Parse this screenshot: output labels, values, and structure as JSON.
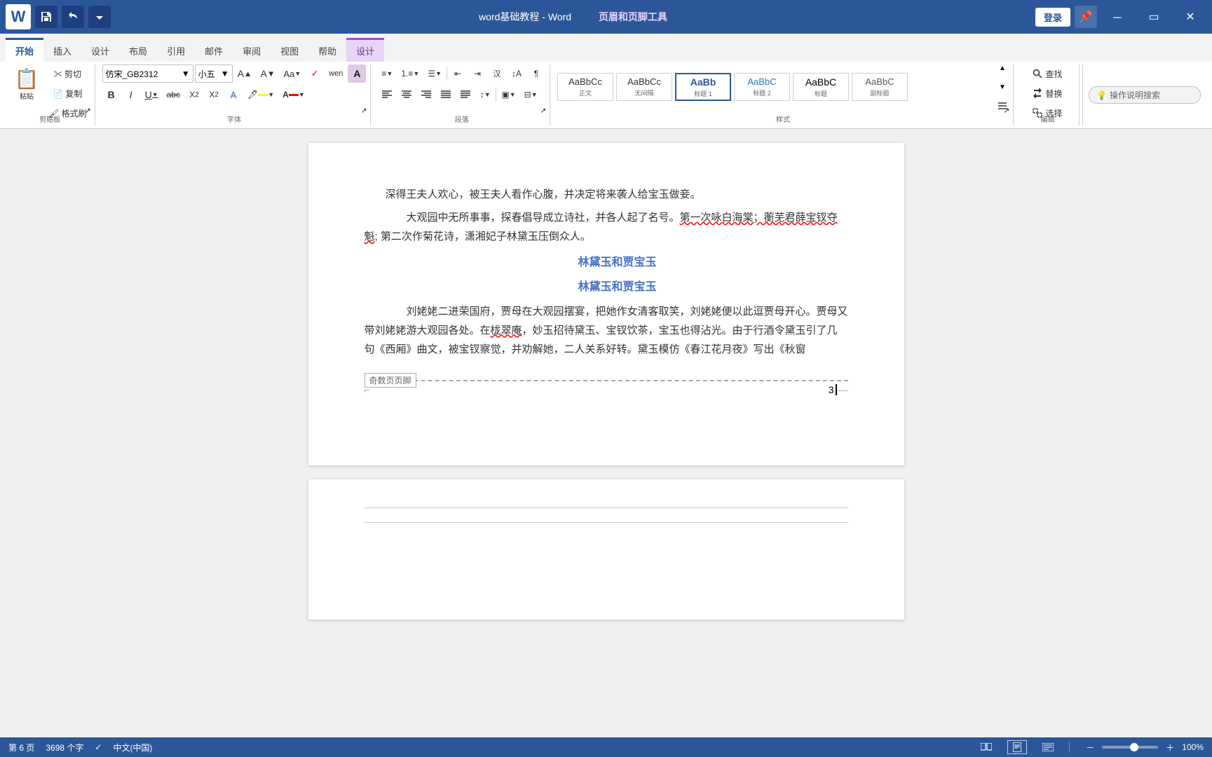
{
  "titleBar": {
    "appName": "Word",
    "docTitle": "word基础教程 - Word",
    "contextTab": "页眉和页脚工具",
    "loginBtn": "登录",
    "minimizeBtn": "－",
    "maximizeBtn": "▭",
    "closeBtn": "✕"
  },
  "tabs": [
    {
      "id": "start",
      "label": "开始",
      "active": true
    },
    {
      "id": "insert",
      "label": "插入"
    },
    {
      "id": "design",
      "label": "设计"
    },
    {
      "id": "layout",
      "label": "布局"
    },
    {
      "id": "references",
      "label": "引用"
    },
    {
      "id": "mail",
      "label": "邮件"
    },
    {
      "id": "review",
      "label": "审阅"
    },
    {
      "id": "view",
      "label": "视图"
    },
    {
      "id": "help",
      "label": "帮助"
    },
    {
      "id": "header-design",
      "label": "设计",
      "isContextTab": true
    }
  ],
  "toolbar": {
    "clipboard": {
      "groupLabel": "剪贴板",
      "paste": "粘贴",
      "cut": "剪切",
      "copy": "复制",
      "formatPainter": "格式刷"
    },
    "font": {
      "groupLabel": "字体",
      "fontName": "仿宋_GB2312",
      "fontSize": "小五",
      "growFont": "A↑",
      "shrinkFont": "A↓",
      "clearFormat": "清",
      "pinyin": "wen",
      "fontOptions": "A",
      "bold": "B",
      "italic": "I",
      "underline": "U",
      "strikethrough": "abc",
      "subscript": "X₂",
      "superscript": "X²",
      "textEffect": "A",
      "highlight": "🖊",
      "fontColor": "A"
    },
    "paragraph": {
      "groupLabel": "段落",
      "bulletList": "≡",
      "numberedList": "1.",
      "multiList": "☰",
      "decreaseIndent": "←",
      "increaseIndent": "→",
      "chinese": "汉",
      "sort": "↕",
      "showMarks": "¶",
      "alignLeft": "≡",
      "alignCenter": "≡",
      "alignRight": "≡",
      "justify": "≡",
      "distributed": "≡",
      "lineSpacing": "↕",
      "shading": "▣",
      "borders": "⊟"
    },
    "styles": {
      "groupLabel": "样式",
      "items": [
        {
          "name": "正文",
          "preview": "AaBbCc",
          "active": false
        },
        {
          "name": "无间隔",
          "preview": "AaBbCc",
          "active": false
        },
        {
          "name": "标题 1",
          "preview": "AaBb",
          "active": true
        },
        {
          "name": "标题 2",
          "preview": "AaBbC",
          "active": false
        },
        {
          "name": "标题",
          "preview": "AaBbC",
          "active": false
        },
        {
          "name": "副标题",
          "preview": "AaBbC",
          "active": false
        }
      ]
    }
  },
  "content": {
    "page1": {
      "paragraphs": [
        "深得王夫人欢心，被王夫人看作心腹，并决定将来袭人给宝玉做妾。",
        "大观园中无所事事，探春倡导成立诗社，并各人起了名号。第一次咏白海棠；蘅芜君薛宝钗夺魁; 第二次作菊花诗，潇湘妃子林黛玉压倒众人。"
      ],
      "titles": [
        "林黛玉和贾宝玉",
        "林黛玉和贾宝玉"
      ],
      "para2": "刘姥姥二进荣国府，贾母在大观园摆宴，把她作女清客取笑，刘姥姥便以此逗贾母开心。贾母又带刘姥姥游大观园各处。在栊翠庵，妙玉招待黛玉、宝钗饮茶，宝玉也得沾光。由于行酒令黛玉引了几句《西厢》曲文，被宝钗察觉，并劝解她，二人关系好转。黛玉模仿《春江花月夜》写出《秋窗"
    },
    "footer": {
      "label": "奇数页页脚",
      "pageNumber": "3"
    }
  },
  "statusBar": {
    "pages": "第 6 页",
    "wordCount": "3698 个字",
    "proofing": "中文(中国)",
    "views": [
      "阅读",
      "页面",
      "Web"
    ],
    "zoom": "100%",
    "zoomMinus": "－",
    "zoomPlus": "＋"
  },
  "helpSearch": {
    "placeholder": "操作说明搜索"
  }
}
